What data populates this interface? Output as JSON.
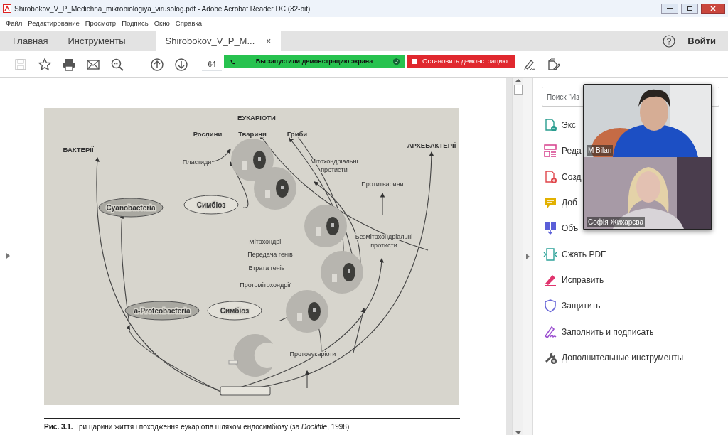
{
  "window": {
    "title": "Shirobokov_V_P_Medichna_mikrobiologiya_virusolog.pdf - Adobe Acrobat Reader DC (32-bit)"
  },
  "menu": [
    "Файл",
    "Редактирование",
    "Просмотр",
    "Подпись",
    "Окно",
    "Справка"
  ],
  "tabs": [
    {
      "label": "Главная",
      "selected": false
    },
    {
      "label": "Инструменты",
      "selected": false
    },
    {
      "label": "Shirobokov_V_P_M...",
      "selected": true,
      "close": "×"
    }
  ],
  "account": {
    "label": "Войти"
  },
  "toolbar": {
    "buttons": [
      {
        "kind": "save",
        "disabled": true
      },
      {
        "kind": "bookmark",
        "disabled": false
      },
      {
        "kind": "print",
        "disabled": false
      },
      {
        "kind": "mail",
        "disabled": false
      },
      {
        "kind": "zoom-out",
        "disabled": false
      },
      {
        "kind": "page-up",
        "disabled": false
      },
      {
        "kind": "page-down",
        "disabled": false
      }
    ],
    "page": "64",
    "right_buttons": [
      {
        "kind": "sign"
      },
      {
        "kind": "edit-doc"
      }
    ]
  },
  "share_banner": {
    "text": "Вы запустили демонстрацию экрана",
    "stop_label": "Остановить демонстрацию"
  },
  "document": {
    "figure": {
      "labels": [
        {
          "kind": "heading",
          "lines": [
            "ЕУКАРІОТИ"
          ]
        },
        {
          "kind": "label",
          "lines": [
            "Рослини"
          ]
        },
        {
          "kind": "label",
          "lines": [
            "Тварини"
          ]
        },
        {
          "kind": "label",
          "lines": [
            "Гриби"
          ]
        },
        {
          "kind": "heading",
          "lines": [
            "БАКТЕРІЇ"
          ]
        },
        {
          "kind": "heading",
          "lines": [
            "АРХЕБАКТЕРІЇ"
          ]
        },
        {
          "kind": "text",
          "lines": [
            "Пластиди"
          ]
        },
        {
          "kind": "text",
          "lines": [
            "Мітохондріальні",
            "протисти"
          ]
        },
        {
          "kind": "text",
          "lines": [
            "Протитварини"
          ]
        },
        {
          "kind": "node",
          "shaded": true,
          "lines": [
            "Cyanobacteria"
          ]
        },
        {
          "kind": "node",
          "shaded": false,
          "lines": [
            "Симбіоз"
          ]
        },
        {
          "kind": "text",
          "lines": [
            "Мітохондрії"
          ]
        },
        {
          "kind": "text",
          "lines": [
            "Безмітохондріальні",
            "протисти"
          ]
        },
        {
          "kind": "text",
          "lines": [
            "Передача генів"
          ]
        },
        {
          "kind": "text",
          "lines": [
            "Втрата генів"
          ]
        },
        {
          "kind": "text",
          "lines": [
            "Протомітохондрії"
          ]
        },
        {
          "kind": "node",
          "shaded": true,
          "lines": [
            "a-Proteobacteria"
          ]
        },
        {
          "kind": "node",
          "shaded": false,
          "lines": [
            "Симбіоз"
          ]
        },
        {
          "kind": "text",
          "lines": [
            "Протоеукаріоти"
          ]
        }
      ]
    },
    "caption": "**Рис. 3.1.** Три царини життя і походження еукаріотів шляхом ендосимбіозу (за *Doolittle*, 1998)"
  },
  "tools_panel": {
    "search": {
      "placeholder": "Поиск \"Из"
    },
    "items": [
      {
        "kind": "export",
        "label": "Экс"
      },
      {
        "kind": "edit",
        "label": "Реда"
      },
      {
        "kind": "create",
        "label": "Созд"
      },
      {
        "kind": "comment",
        "label": "Доб"
      },
      {
        "kind": "combine",
        "label": "Объ"
      },
      {
        "kind": "compress",
        "label": "Сжать PDF"
      },
      {
        "kind": "redact",
        "label": "Исправить"
      },
      {
        "kind": "protect",
        "label": "Защитить"
      },
      {
        "kind": "fill-sign",
        "label": "Заполнить и подписать"
      },
      {
        "kind": "more",
        "label": "Дополнительные инструменты"
      }
    ]
  },
  "video": [
    {
      "name": "M Bilan",
      "kind": "hoodie"
    },
    {
      "name": "Софія Жихарєва",
      "kind": "blonde"
    }
  ]
}
